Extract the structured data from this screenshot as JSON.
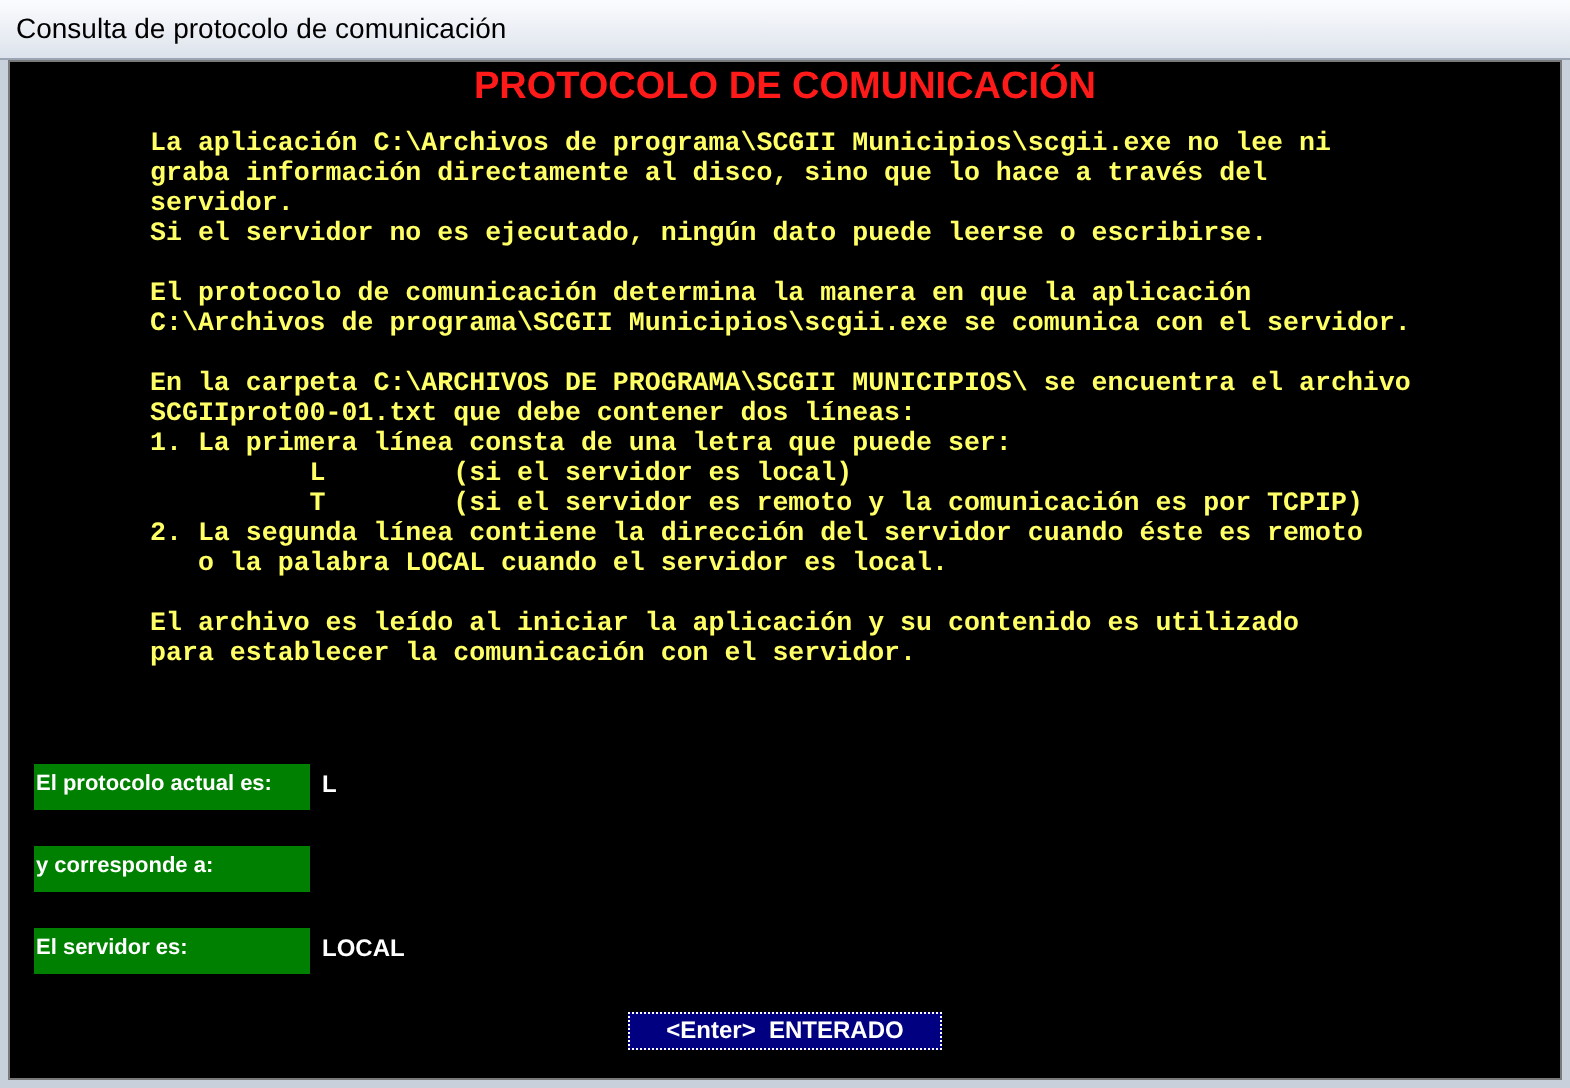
{
  "window": {
    "title": "Consulta de protocolo de comunicación"
  },
  "heading": "PROTOCOLO DE COMUNICACIÓN",
  "paragraphs": [
    {
      "lines": [
        "La aplicación C:\\Archivos de programa\\SCGII Municipios\\scgii.exe no lee ni",
        "graba información directamente al disco, sino que lo hace a través del",
        "servidor.",
        "Si el servidor no es ejecutado, ningún dato puede leerse o escribirse."
      ]
    },
    {
      "lines": [
        "El protocolo de comunicación determina la manera en que la aplicación",
        "C:\\Archivos de programa\\SCGII Municipios\\scgii.exe se comunica con el servidor."
      ]
    },
    {
      "lines": [
        "En la carpeta C:\\ARCHIVOS DE PROGRAMA\\SCGII MUNICIPIOS\\ se encuentra el archivo",
        "SCGIIprot00-01.txt que debe contener dos líneas:",
        "1. La primera línea consta de una letra que puede ser:",
        "          L        (si el servidor es local)",
        "          T        (si el servidor es remoto y la comunicación es por TCPIP)",
        "2. La segunda línea contiene la dirección del servidor cuando éste es remoto",
        "   o la palabra LOCAL cuando el servidor es local."
      ]
    },
    {
      "lines": [
        "El archivo es leído al iniciar la aplicación y su contenido es utilizado",
        "para establecer la comunicación con el servidor."
      ]
    }
  ],
  "fields": [
    {
      "label": "El protocolo actual es:",
      "value": "L"
    },
    {
      "label": "y corresponde a:"
    },
    {
      "label": "El servidor es:",
      "value": "LOCAL"
    }
  ],
  "button": {
    "label": "<Enter>  ENTERADO"
  }
}
